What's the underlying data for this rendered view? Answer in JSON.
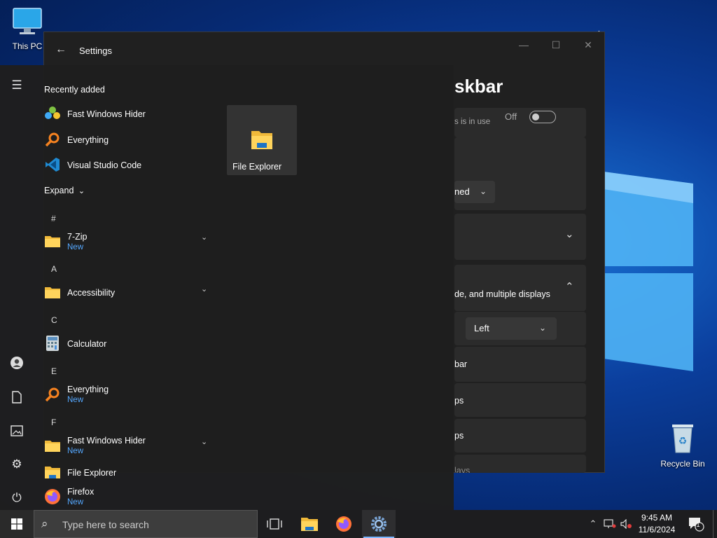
{
  "desktop": {
    "this_pc_label": "This PC",
    "recycle_bin_label": "Recycle Bin"
  },
  "settings": {
    "window_title": "Settings",
    "page_heading": "skbar",
    "toggle_hint": "s is in use",
    "toggle_state": "Off",
    "dropdown1_value": "ned",
    "multi_display_text": "de, and multiple displays",
    "alignment_value": "Left",
    "row_bar": "bar",
    "row_ps1": "ps",
    "row_ps2": "ps",
    "row_lays": "lays"
  },
  "start_menu": {
    "recently_added_label": "Recently added",
    "recent": [
      {
        "name": "Fast Windows Hider",
        "icon": "fast-windows-hider-icon"
      },
      {
        "name": "Everything",
        "icon": "everything-icon"
      },
      {
        "name": "Visual Studio Code",
        "icon": "vscode-icon"
      }
    ],
    "expand_label": "Expand",
    "groups": [
      {
        "letter": "#",
        "apps": [
          {
            "name": "7-Zip",
            "badge": "New",
            "expandable": true
          }
        ]
      },
      {
        "letter": "A",
        "apps": [
          {
            "name": "Accessibility",
            "badge": "",
            "expandable": true
          }
        ]
      },
      {
        "letter": "C",
        "apps": [
          {
            "name": "Calculator",
            "badge": "",
            "expandable": false
          }
        ]
      },
      {
        "letter": "E",
        "apps": [
          {
            "name": "Everything",
            "badge": "New",
            "expandable": false
          }
        ]
      },
      {
        "letter": "F",
        "apps": [
          {
            "name": "Fast Windows Hider",
            "badge": "New",
            "expandable": true
          },
          {
            "name": "File Explorer",
            "badge": "",
            "expandable": false
          },
          {
            "name": "Firefox",
            "badge": "New",
            "expandable": false
          }
        ]
      }
    ],
    "pinned_tile_label": "File Explorer"
  },
  "taskbar": {
    "search_placeholder": "Type here to search",
    "time": "9:45 AM",
    "date": "11/6/2024",
    "notification_count": "1"
  },
  "colors": {
    "accent": "#55a8ff",
    "taskbar": "#1d1d1f",
    "start_bg": "#1f1f1f",
    "settings_bg": "#202020"
  }
}
